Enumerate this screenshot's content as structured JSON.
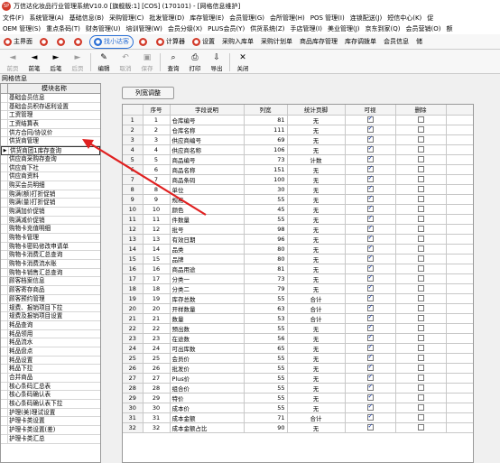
{
  "app": {
    "title": "万信达化妆品行业管理系统V10.0 [旗舰版:1]  [COS] (170101) - [网格信息维护]",
    "logo_text": "SP"
  },
  "menu": {
    "row1": [
      "文件(F)",
      "系统管理(A)",
      "基础信息(B)",
      "采购管理(C)",
      "批发管理(D)",
      "库存管理(E)",
      "会员管理(G)",
      "会所管理(H)",
      "POS 管理(I)",
      "连锁配送(J)",
      "短信中心(K)",
      "促"
    ],
    "row2": [
      "OEM 管理(S)",
      "重点条码(T)",
      "财务管理(U)",
      "培训管理(W)",
      "会员分级(X)",
      "PLUS会员(Y)",
      "供货系统(Z)",
      "手店管理(I)",
      "美业管理(J)",
      "京东到家(Q)",
      "会员营销(O)",
      "额"
    ]
  },
  "quickbar": [
    {
      "label": "主界面",
      "icon": "home-icon",
      "color": "#d23a2a"
    },
    {
      "label": "",
      "icon": "red-circle-icon",
      "color": "#d23a2a"
    },
    {
      "label": "",
      "icon": "stop-icon",
      "color": "#d23a2a"
    },
    {
      "label": "",
      "icon": "warning-icon",
      "color": "#d23a2a"
    },
    {
      "label": "找小达客",
      "icon": "assistant-icon",
      "color": "#2a6fd6"
    },
    {
      "label": "",
      "icon": "info-icon",
      "color": "#d23a2a"
    },
    {
      "label": "计算器",
      "icon": "calculator-icon",
      "color": "#d23a2a"
    },
    {
      "label": "设置",
      "icon": "gear-icon",
      "color": "#d23a2a"
    },
    {
      "label": "采购入库单",
      "icon": "",
      "color": ""
    },
    {
      "label": "采购计划单",
      "icon": "",
      "color": ""
    },
    {
      "label": "商品库存管理",
      "icon": "",
      "color": ""
    },
    {
      "label": "库存调拨单",
      "icon": "",
      "color": ""
    },
    {
      "label": "会员信息",
      "icon": "",
      "color": ""
    },
    {
      "label": "储",
      "icon": "",
      "color": ""
    }
  ],
  "toolbar": [
    {
      "label": "前页",
      "glyph": "◄",
      "disabled": true
    },
    {
      "label": "前笔",
      "glyph": "◄",
      "disabled": false
    },
    {
      "label": "后笔",
      "glyph": "►",
      "disabled": false
    },
    {
      "label": "后页",
      "glyph": "►",
      "disabled": true
    },
    {
      "label": "编辑",
      "glyph": "✎",
      "disabled": false
    },
    {
      "label": "取消",
      "glyph": "↶",
      "disabled": true
    },
    {
      "label": "保存",
      "glyph": "▣",
      "disabled": true
    },
    {
      "label": "查询",
      "glyph": "⌕",
      "disabled": false
    },
    {
      "label": "打印",
      "glyph": "⎙",
      "disabled": false
    },
    {
      "label": "导出",
      "glyph": "⇩",
      "disabled": false
    },
    {
      "label": "关闭",
      "glyph": "✕",
      "disabled": false
    }
  ],
  "window_info": "网格信息",
  "left": {
    "header": "模块名称",
    "selected_index": 6,
    "items": [
      "基础会员信息",
      "基础会员积存返利设置",
      "工资管理",
      "工资结算表",
      "供方合同/协议价",
      "供货商管理",
      "供货商团1库存查询",
      "供应商采购存查询",
      "供应商下社",
      "供应商资料",
      "购买会员明细",
      "购满(额)打折促销",
      "购满(量)打折促销",
      "购满加价促销",
      "购满减价促销",
      "购物卡充值明细",
      "购物卡管理",
      "购物卡密码修改申请单",
      "购物卡消费汇总查询",
      "购物卡消费流水账",
      "购物卡销售汇总查询",
      "顾客档案信息",
      "顾客寄存商品",
      "顾客预约管理",
      "规费、报销项目下拉",
      "规费及报销项目设置",
      "耗品查询",
      "耗品领用",
      "耗品流水",
      "耗品盘点",
      "耗品设置",
      "耗品下拉",
      "合并商品",
      "核心条码汇总表",
      "核心条码确认表",
      "核心条码确认表下拉",
      "护理(美)理试设置",
      "护理卡类设置",
      "护理卡类设置(差)",
      "护理卡类汇总"
    ]
  },
  "right": {
    "button_label": "列宽调整",
    "columns": [
      "序号",
      "字段说明",
      "列宽",
      "统计页脚",
      "可视",
      "删除"
    ],
    "rows": [
      {
        "n": 1,
        "field": "仓库编号",
        "width": 81,
        "stat": "无",
        "visible": true,
        "del": false
      },
      {
        "n": 2,
        "field": "仓库名称",
        "width": 111,
        "stat": "无",
        "visible": true,
        "del": false
      },
      {
        "n": 3,
        "field": "供应商编号",
        "width": 69,
        "stat": "无",
        "visible": true,
        "del": false
      },
      {
        "n": 4,
        "field": "供应商名称",
        "width": 106,
        "stat": "无",
        "visible": true,
        "del": false
      },
      {
        "n": 5,
        "field": "商品编号",
        "width": 73,
        "stat": "计数",
        "visible": true,
        "del": false
      },
      {
        "n": 6,
        "field": "商品名称",
        "width": 151,
        "stat": "无",
        "visible": true,
        "del": false
      },
      {
        "n": 7,
        "field": "商品条码",
        "width": 100,
        "stat": "无",
        "visible": true,
        "del": false
      },
      {
        "n": 8,
        "field": "单位",
        "width": 30,
        "stat": "无",
        "visible": true,
        "del": false
      },
      {
        "n": 9,
        "field": "规格",
        "width": 55,
        "stat": "无",
        "visible": true,
        "del": false
      },
      {
        "n": 10,
        "field": "颜色",
        "width": 45,
        "stat": "无",
        "visible": true,
        "del": false
      },
      {
        "n": 11,
        "field": "件数量",
        "width": 55,
        "stat": "无",
        "visible": true,
        "del": false
      },
      {
        "n": 12,
        "field": "批号",
        "width": 98,
        "stat": "无",
        "visible": true,
        "del": false
      },
      {
        "n": 13,
        "field": "有效日期",
        "width": 96,
        "stat": "无",
        "visible": true,
        "del": false
      },
      {
        "n": 14,
        "field": "品类",
        "width": 80,
        "stat": "无",
        "visible": true,
        "del": false
      },
      {
        "n": 15,
        "field": "品牌",
        "width": 80,
        "stat": "无",
        "visible": true,
        "del": false
      },
      {
        "n": 16,
        "field": "商品用途",
        "width": 81,
        "stat": "无",
        "visible": true,
        "del": false
      },
      {
        "n": 17,
        "field": "分类一",
        "width": 73,
        "stat": "无",
        "visible": true,
        "del": false
      },
      {
        "n": 18,
        "field": "分类二",
        "width": 79,
        "stat": "无",
        "visible": true,
        "del": false
      },
      {
        "n": 19,
        "field": "库存总数",
        "width": 55,
        "stat": "合计",
        "visible": true,
        "del": false
      },
      {
        "n": 20,
        "field": "开样数量",
        "width": 63,
        "stat": "合计",
        "visible": true,
        "del": false
      },
      {
        "n": 21,
        "field": "数量",
        "width": 53,
        "stat": "合计",
        "visible": true,
        "del": false
      },
      {
        "n": 22,
        "field": "预出数",
        "width": 55,
        "stat": "无",
        "visible": true,
        "del": false
      },
      {
        "n": 23,
        "field": "在途数",
        "width": 56,
        "stat": "无",
        "visible": true,
        "del": false
      },
      {
        "n": 24,
        "field": "可出库数",
        "width": 65,
        "stat": "无",
        "visible": true,
        "del": false
      },
      {
        "n": 25,
        "field": "会员价",
        "width": 55,
        "stat": "无",
        "visible": true,
        "del": false
      },
      {
        "n": 26,
        "field": "批发价",
        "width": 55,
        "stat": "无",
        "visible": true,
        "del": false
      },
      {
        "n": 27,
        "field": "Plus价",
        "width": 55,
        "stat": "无",
        "visible": true,
        "del": false
      },
      {
        "n": 28,
        "field": "组合价",
        "width": 55,
        "stat": "无",
        "visible": true,
        "del": false
      },
      {
        "n": 29,
        "field": "特价",
        "width": 55,
        "stat": "无",
        "visible": true,
        "del": false
      },
      {
        "n": 30,
        "field": "成本价",
        "width": 55,
        "stat": "无",
        "visible": true,
        "del": false
      },
      {
        "n": 31,
        "field": "成本金额",
        "width": 71,
        "stat": "合计",
        "visible": true,
        "del": false
      },
      {
        "n": 32,
        "field": "成本金额占比",
        "width": 90,
        "stat": "无",
        "visible": true,
        "del": false
      }
    ]
  },
  "colors": {
    "accent": "#2a6fd6",
    "brand_red": "#d23a2a",
    "annotation_arrow": "#e02020"
  }
}
